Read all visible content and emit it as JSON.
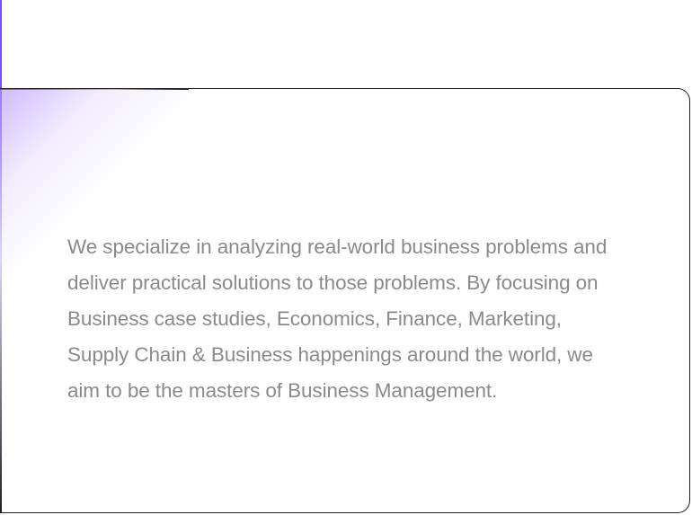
{
  "card": {
    "description": "We specialize in analyzing real-world business problems and deliver practical solutions to those problems. By focusing on Business case studies, Economics, Finance, Marketing, Supply Chain & Business happenings around the world, we aim to be the masters of Business Management."
  },
  "colors": {
    "accent": "#7b4dff",
    "border": "#1f1f1f",
    "text": "#8a8a8a",
    "background": "#ffffff"
  }
}
